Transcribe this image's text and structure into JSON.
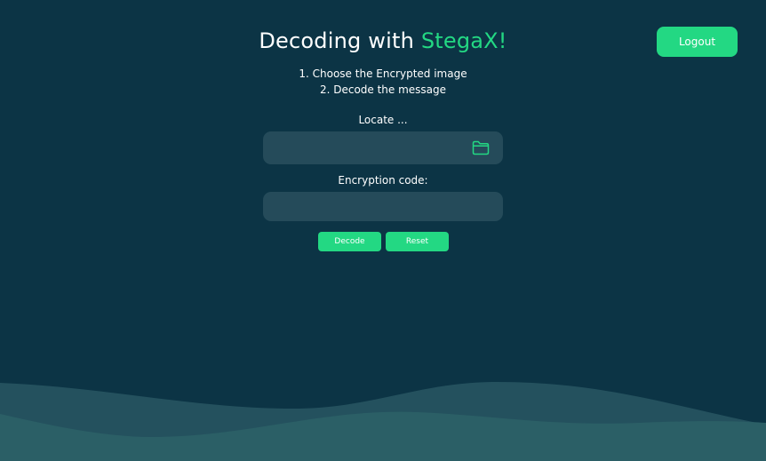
{
  "header": {
    "title_prefix": "Decoding with ",
    "title_brand": "StegaX!",
    "logout_label": "Logout"
  },
  "instructions": {
    "steps": [
      "1. Choose the Encrypted image",
      "2. Decode the message"
    ]
  },
  "form": {
    "locate_label": "Locate ...",
    "file_path_value": "",
    "code_label": "Encryption code:",
    "code_value": "",
    "decode_label": "Decode",
    "reset_label": "Reset"
  },
  "icons": {
    "folder": "folder-icon"
  },
  "colors": {
    "background": "#0c3445",
    "accent": "#23d883",
    "field": "#254b5a",
    "wave_back": "#24515e",
    "wave_front": "#2b5f66"
  }
}
